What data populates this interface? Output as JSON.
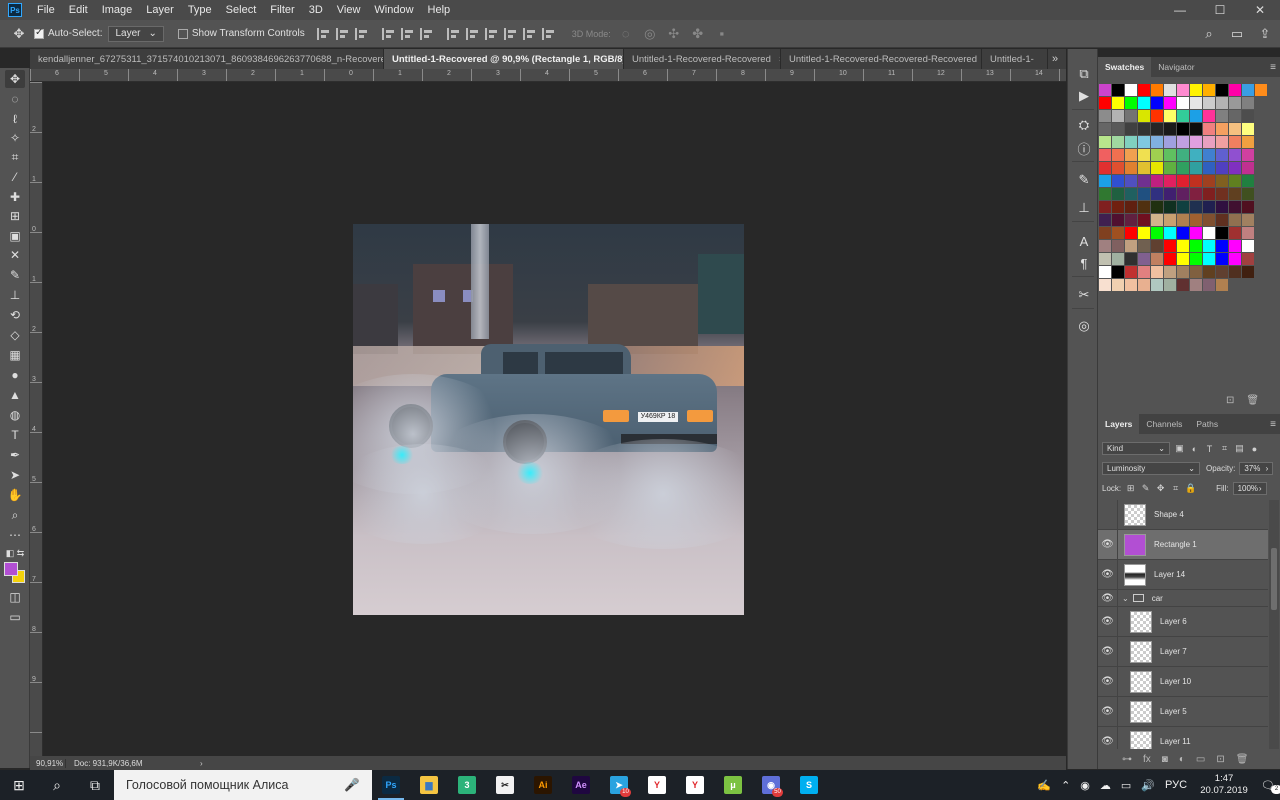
{
  "app": {
    "logo": "Ps"
  },
  "menu": [
    "File",
    "Edit",
    "Image",
    "Layer",
    "Type",
    "Select",
    "Filter",
    "3D",
    "View",
    "Window",
    "Help"
  ],
  "window_controls": {
    "minimize": "—",
    "maximize": "☐",
    "close": "✕"
  },
  "options": {
    "auto_select_label": "Auto-Select:",
    "auto_select_checked": true,
    "auto_select_value": "Layer",
    "transform_label": "Show Transform Controls",
    "transform_checked": false,
    "mode_3d_label": "3D Mode:"
  },
  "tabs": [
    {
      "label": "kendalljenner_67275311_371574010213071_8609384696263770688_n-Recovered.jpg",
      "active": false
    },
    {
      "label": "Untitled-1-Recovered @ 90,9% (Rectangle 1, RGB/8) *",
      "active": true
    },
    {
      "label": "Untitled-1-Recovered-Recovered",
      "active": false
    },
    {
      "label": "Untitled-1-Recovered-Recovered-Recovered",
      "active": false
    },
    {
      "label": "Untitled-1-",
      "active": false
    }
  ],
  "tab_close": "×",
  "tab_overflow": "»",
  "ruler_top_labels": [
    "6",
    "5",
    "4",
    "3",
    "2",
    "1",
    "0",
    "1",
    "2",
    "3",
    "4",
    "5",
    "6",
    "7",
    "8",
    "9",
    "10",
    "11",
    "12",
    "13",
    "14",
    "15",
    "16",
    "17",
    "18",
    "19",
    "20"
  ],
  "ruler_left_labels": [
    "2",
    "1",
    "0",
    "1",
    "2",
    "3",
    "4",
    "5",
    "6",
    "7",
    "8",
    "9"
  ],
  "plate_text": "У469КР 18",
  "status": {
    "zoom": "90,91%",
    "doc": "Doc: 931,9K/36,6M",
    "arrow": "›"
  },
  "colors": {
    "foreground": "#b24fd3",
    "background": "#f4d20b",
    "accent": "#31a8ff"
  },
  "panels": {
    "swatches_tabs": [
      "Swatches",
      "Navigator"
    ],
    "layers_tabs": [
      "Layers",
      "Channels",
      "Paths"
    ],
    "filter_kind": "Kind",
    "blend_mode": "Luminosity",
    "opacity_label": "Opacity:",
    "opacity_value": "37%",
    "lock_label": "Lock:",
    "fill_label": "Fill:",
    "fill_value": "100%"
  },
  "swatch_rows": [
    [
      "#cc44cc",
      "#000000",
      "#ffffff",
      "#ff0000",
      "#ff7a00",
      "#e0e0e0",
      "#ff8ad0",
      "#fff200",
      "#ffb000",
      "#000000",
      "#ff00a8",
      "#3a9ee4",
      "#ff8c1a"
    ],
    [
      "#ff0000",
      "#ffff00",
      "#00ff00",
      "#00ffff",
      "#0000ff",
      "#ff00ff",
      "#ffffff",
      "#e6e6e6",
      "#cccccc",
      "#b3b3b3",
      "#999999",
      "#808080"
    ],
    [
      "#8c8c8c",
      "#b3b3b3",
      "#737373",
      "#d9e600",
      "#ff3300",
      "#ffff66",
      "#33cc99",
      "#1ca0e6",
      "#ff3399",
      "#808080",
      "#666666",
      "#4d4d4d"
    ],
    [
      "#666666",
      "#595959",
      "#404040",
      "#333333",
      "#262626",
      "#1a1a1a",
      "#000000",
      "#0d0d0d",
      "#f08080",
      "#f5a060",
      "#f5c080",
      "#ffff80"
    ],
    [
      "#b8e68c",
      "#a0d8a0",
      "#80d0c0",
      "#80c8e0",
      "#80b0e0",
      "#a0a0e0",
      "#c0a0e0",
      "#e0a0e0",
      "#e8a0c0",
      "#f0a0a0",
      "#f08060",
      "#f0a040"
    ],
    [
      "#f06060",
      "#f07050",
      "#f0a050",
      "#f0e050",
      "#a0d050",
      "#60c060",
      "#40b080",
      "#40b0c0",
      "#4080d0",
      "#6060d0",
      "#9050d0",
      "#d040a0"
    ],
    [
      "#e03030",
      "#e05030",
      "#e08030",
      "#e0c030",
      "#e6e600",
      "#60b040",
      "#30a060",
      "#30a0a0",
      "#3060c0",
      "#5040c0",
      "#8030c0",
      "#c03090"
    ],
    [
      "#1ca0e6",
      "#3050d0",
      "#5050c0",
      "#703090",
      "#c02080",
      "#e02060",
      "#e02030",
      "#c03020",
      "#a04020",
      "#806020",
      "#608020",
      "#208040"
    ],
    [
      "#307830",
      "#206040",
      "#206060",
      "#205080",
      "#303080",
      "#402070",
      "#602060",
      "#802040",
      "#802020",
      "#703020",
      "#604020",
      "#405020"
    ],
    [
      "#802020",
      "#702010",
      "#602010",
      "#503010",
      "#203010",
      "#103020",
      "#104040",
      "#203050",
      "#202050",
      "#301040",
      "#401030",
      "#501020"
    ],
    [
      "#402050",
      "#501030",
      "#602040",
      "#701020",
      "#d2b48c",
      "#c8a070",
      "#b08050",
      "#a06030",
      "#805030",
      "#603020",
      "#907050",
      "#a08060"
    ],
    [
      "#804020",
      "#a05020",
      "#ff0000",
      "#ffff00",
      "#00ff00",
      "#00ffff",
      "#0000ff",
      "#ff00ff",
      "#ffffff",
      "#000000",
      "#a03030",
      "#c08080"
    ],
    [
      "#a08080",
      "#806060",
      "#c0a080",
      "#706050",
      "#604030",
      "#ff0000",
      "#ffff00",
      "#00ff00",
      "#00ffff",
      "#0000ff",
      "#ff00ff",
      "#ffffff"
    ],
    [
      "#c0c0b0",
      "#a0b0a0",
      "#303030",
      "#806090",
      "#c08060",
      "#ff0000",
      "#ffff00",
      "#00ff00",
      "#00ffff",
      "#0000ff",
      "#ff00ff",
      "#a04040"
    ],
    [
      "#ffffff",
      "#000000",
      "#c03030",
      "#e08080",
      "#f0c0a0",
      "#c0a080",
      "#a08060",
      "#806040",
      "#604020",
      "#604030",
      "#503020",
      "#402010"
    ],
    [
      "#f8e0d0",
      "#f0d0b0",
      "#f0c0a0",
      "#e8b090",
      "#b0c8c0",
      "#a0b0a0",
      "#603030",
      "#a08080",
      "#806070",
      "#b08050"
    ]
  ],
  "layers": [
    {
      "name": "Shape 4",
      "visible": false,
      "thumb": "checker",
      "selected": false
    },
    {
      "name": "Rectangle 1",
      "visible": true,
      "thumb": "purple",
      "selected": true
    },
    {
      "name": "Layer 14",
      "visible": true,
      "thumb": "mask",
      "selected": false
    },
    {
      "name": "car",
      "visible": true,
      "group": true
    },
    {
      "name": "Layer 6",
      "visible": true,
      "thumb": "checker",
      "indent": true
    },
    {
      "name": "Layer 7",
      "visible": true,
      "thumb": "checker",
      "indent": true
    },
    {
      "name": "Layer 10",
      "visible": true,
      "thumb": "checker",
      "indent": true
    },
    {
      "name": "Layer 5",
      "visible": true,
      "thumb": "checker",
      "indent": true
    },
    {
      "name": "Layer 11",
      "visible": true,
      "thumb": "carthumb",
      "indent": true
    }
  ],
  "taskbar": {
    "search_placeholder": "Голосовой помощник Алиса",
    "apps": [
      {
        "name": "photoshop",
        "label": "Ps",
        "bg": "#0b2a42",
        "fg": "#31a8ff",
        "running": true
      },
      {
        "name": "explorer",
        "label": "▆",
        "bg": "#f5c542",
        "fg": "#3a78c2",
        "running": false
      },
      {
        "name": "app-3",
        "label": "3",
        "bg": "#2cb37a",
        "fg": "#ffffff",
        "running": false
      },
      {
        "name": "app-tool",
        "label": "✂",
        "bg": "#f2f2f2",
        "fg": "#222222",
        "running": false
      },
      {
        "name": "illustrator",
        "label": "Ai",
        "bg": "#2b1500",
        "fg": "#ff9a00",
        "running": false
      },
      {
        "name": "after-effects",
        "label": "Ae",
        "bg": "#1f0740",
        "fg": "#d291ff",
        "running": false
      },
      {
        "name": "telegram",
        "label": "➤",
        "bg": "#2aa3e0",
        "fg": "#ffffff",
        "running": false,
        "badge": "10"
      },
      {
        "name": "yandex",
        "label": "Y",
        "bg": "#ffffff",
        "fg": "#e0262b",
        "running": false
      },
      {
        "name": "yandex-browser",
        "label": "Y",
        "bg": "#ffffff",
        "fg": "#e0262b",
        "running": false
      },
      {
        "name": "utorrent",
        "label": "μ",
        "bg": "#7cc242",
        "fg": "#ffffff",
        "running": false
      },
      {
        "name": "discord",
        "label": "◉",
        "bg": "#5f6fd8",
        "fg": "#ffffff",
        "running": false,
        "badge": "50"
      },
      {
        "name": "skype",
        "label": "S",
        "bg": "#00aff0",
        "fg": "#ffffff",
        "running": false
      }
    ],
    "lang": "РУС",
    "time": "1:47",
    "date": "20.07.2019",
    "notif_count": "2"
  }
}
